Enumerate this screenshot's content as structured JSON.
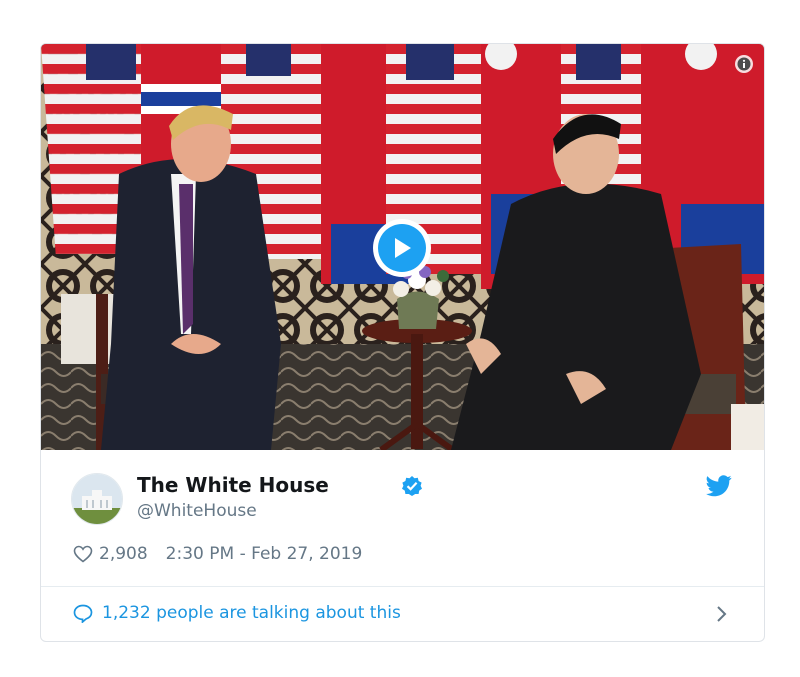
{
  "tweet": {
    "author_name": "The White House",
    "author_handle": "@WhiteHouse",
    "likes": "2,908",
    "timestamp": "2:30 PM - Feb 27, 2019",
    "conversation": "1,232 people are talking about this"
  },
  "icons": {
    "verified": "verified-badge-icon",
    "twitter": "twitter-bird-icon",
    "like": "heart-icon",
    "reply": "speech-bubble-icon",
    "info": "info-icon",
    "play": "play-icon",
    "chevron": "chevron-right-icon"
  },
  "colors": {
    "accent": "#1da1f2",
    "link": "#1b95e0",
    "muted": "#657786",
    "text": "#14171a"
  }
}
